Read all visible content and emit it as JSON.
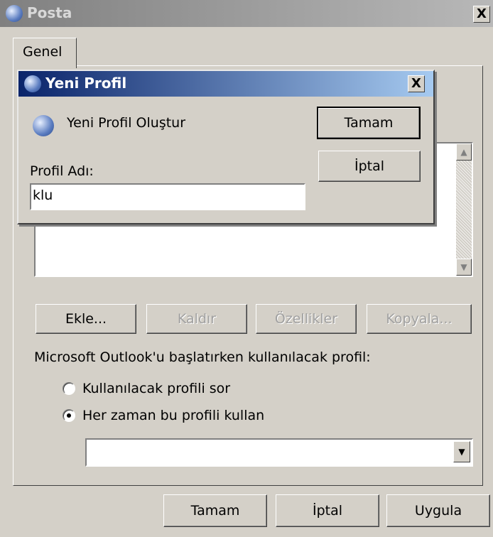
{
  "window": {
    "title": "Posta",
    "close_glyph": "X"
  },
  "tabs": [
    {
      "label": "Genel"
    }
  ],
  "profile_list": {
    "items": [],
    "scroll_up_icon": "arrow-up",
    "scroll_down_icon": "arrow-down"
  },
  "profile_buttons": {
    "add": "Ekle...",
    "remove": "Kaldır",
    "properties": "Özellikler",
    "copy": "Kopyala..."
  },
  "startup": {
    "label": "Microsoft Outlook'u başlatırken kullanılacak profil:",
    "option_ask": "Kullanılacak profili sor",
    "option_always": "Her zaman bu profili kullan",
    "selected_option": "always",
    "profile_combo_value": ""
  },
  "footer": {
    "ok": "Tamam",
    "cancel": "İptal",
    "apply": "Uygula"
  },
  "new_profile_dialog": {
    "title": "Yeni Profil",
    "close_glyph": "X",
    "description": "Yeni Profil Oluştur",
    "ok": "Tamam",
    "cancel": "İptal",
    "name_label": "Profil Adı:",
    "name_value": "klu"
  },
  "colors": {
    "active_title": "#0a246a",
    "inactive_title": "#808080",
    "face": "#d4d0c8"
  }
}
